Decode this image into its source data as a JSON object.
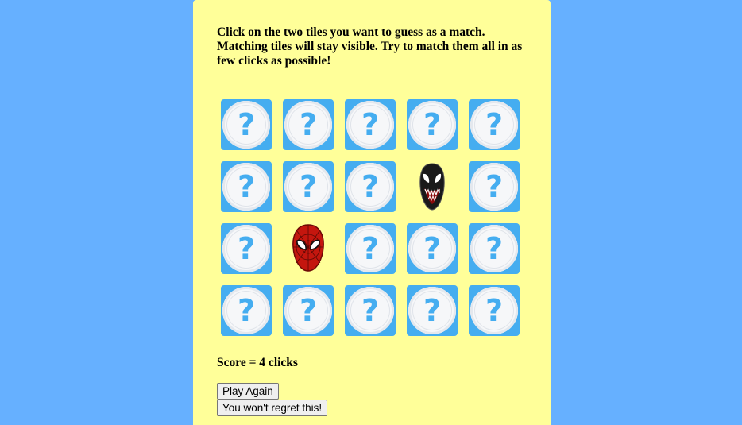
{
  "instructions": "Click on the two tiles you want to guess as a match. Matching tiles will stay visible. Try to match them all in as few clicks as possible!",
  "tiles": [
    {
      "state": "hidden",
      "icon": "question-mark-icon",
      "glyph": "?"
    },
    {
      "state": "hidden",
      "icon": "question-mark-icon",
      "glyph": "?"
    },
    {
      "state": "hidden",
      "icon": "question-mark-icon",
      "glyph": "?"
    },
    {
      "state": "hidden",
      "icon": "question-mark-icon",
      "glyph": "?"
    },
    {
      "state": "hidden",
      "icon": "question-mark-icon",
      "glyph": "?"
    },
    {
      "state": "hidden",
      "icon": "question-mark-icon",
      "glyph": "?"
    },
    {
      "state": "hidden",
      "icon": "question-mark-icon",
      "glyph": "?"
    },
    {
      "state": "hidden",
      "icon": "question-mark-icon",
      "glyph": "?"
    },
    {
      "state": "revealed",
      "icon": "venom-mask-icon"
    },
    {
      "state": "hidden",
      "icon": "question-mark-icon",
      "glyph": "?"
    },
    {
      "state": "hidden",
      "icon": "question-mark-icon",
      "glyph": "?"
    },
    {
      "state": "revealed",
      "icon": "spiderman-mask-icon"
    },
    {
      "state": "hidden",
      "icon": "question-mark-icon",
      "glyph": "?"
    },
    {
      "state": "hidden",
      "icon": "question-mark-icon",
      "glyph": "?"
    },
    {
      "state": "hidden",
      "icon": "question-mark-icon",
      "glyph": "?"
    },
    {
      "state": "hidden",
      "icon": "question-mark-icon",
      "glyph": "?"
    },
    {
      "state": "hidden",
      "icon": "question-mark-icon",
      "glyph": "?"
    },
    {
      "state": "hidden",
      "icon": "question-mark-icon",
      "glyph": "?"
    },
    {
      "state": "hidden",
      "icon": "question-mark-icon",
      "glyph": "?"
    },
    {
      "state": "hidden",
      "icon": "question-mark-icon",
      "glyph": "?"
    }
  ],
  "score_text": "Score = 4 clicks",
  "buttons": {
    "play_again": "Play Again",
    "regret": "You won't regret this!"
  },
  "colors": {
    "page_bg": "#66b0ff",
    "panel_bg": "#ffff99",
    "tile_bg": "#45adf0",
    "tile_disc": "#f6f7f9"
  }
}
